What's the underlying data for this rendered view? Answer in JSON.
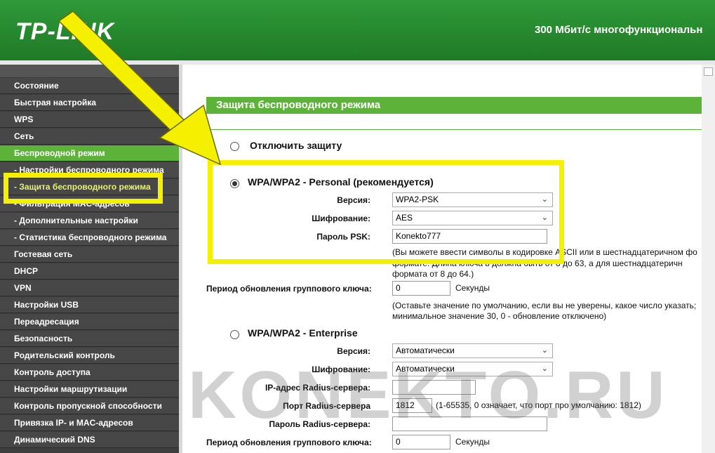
{
  "header": {
    "logo": "TP-LINK",
    "title": "300 Мбит/с многофункциональн"
  },
  "sidebar": {
    "items": [
      {
        "label": "Состояние"
      },
      {
        "label": "Быстрая настройка"
      },
      {
        "label": "WPS"
      },
      {
        "label": "Сеть"
      },
      {
        "label": "Беспроводной режим",
        "active": true
      },
      {
        "label": "- Настройки беспроводного режима"
      },
      {
        "label": "- Защита беспроводного режима"
      },
      {
        "label": "- Фильтрация MAC-адресов"
      },
      {
        "label": "- Дополнительные настройки"
      },
      {
        "label": "- Статистика беспроводного режима"
      },
      {
        "label": "Гостевая сеть"
      },
      {
        "label": "DHCP"
      },
      {
        "label": "VPN"
      },
      {
        "label": "Настройки USB"
      },
      {
        "label": "Переадресация"
      },
      {
        "label": "Безопасность"
      },
      {
        "label": "Родительский контроль"
      },
      {
        "label": "Контроль доступа"
      },
      {
        "label": "Настройки маршрутизации"
      },
      {
        "label": "Контроль пропускной способности"
      },
      {
        "label": "Привязка IP- и MAC-адресов"
      },
      {
        "label": "Динамический DNS"
      }
    ]
  },
  "content": {
    "section_title": "Защита беспроводного режима",
    "disable_option": "Отключить защиту",
    "personal": {
      "label": "WPA/WPA2 - Personal (рекомендуется)",
      "version_label": "Версия:",
      "version_value": "WPA2-PSK",
      "encryption_label": "Шифрование:",
      "encryption_value": "AES",
      "psk_label": "Пароль PSK:",
      "psk_value": "Konekto777",
      "psk_hint_1": "(Вы можете ввести символы в кодировке ASCII или в шестнадцатеричном фо",
      "psk_hint_2": "формате. Длина ключа в должна быть от 8 до 63, а для шестнадцатеричн",
      "psk_hint_3": "формата от 8 до 64.)",
      "group_key_label": "Период обновления группового ключа:",
      "group_key_value": "0",
      "group_key_unit": "Секунды",
      "group_hint_1": "(Оставьте значение по умолчанию, если вы не уверены, какое число указать;",
      "group_hint_2": "минимальное значение 30, 0 - обновление отключено)"
    },
    "enterprise": {
      "label": "WPA/WPA2 - Enterprise",
      "version_label": "Версия:",
      "version_value": "Автоматически",
      "encryption_label": "Шифрование:",
      "encryption_value": "Автоматически",
      "radius_ip_label": "IP-адрес Radius-сервера:",
      "radius_ip_value": "",
      "radius_port_label": "Порт Radius-сервера",
      "radius_port_value": "1812",
      "radius_port_hint": "(1-65535, 0 означает, что порт про умолчанию: 1812)",
      "radius_pass_label": "Пароль Radius-сервера:",
      "radius_pass_value": "",
      "group_key_label": "Период обновления группового ключа:",
      "group_key_value": "0",
      "group_key_unit": "Секунды"
    }
  },
  "watermark": "KONEKTO.RU",
  "colors": {
    "header_green": "#2f9a37",
    "accent_green": "#5db33a",
    "sidebar_bg": "#474747",
    "highlight_yellow": "#f5f000"
  }
}
